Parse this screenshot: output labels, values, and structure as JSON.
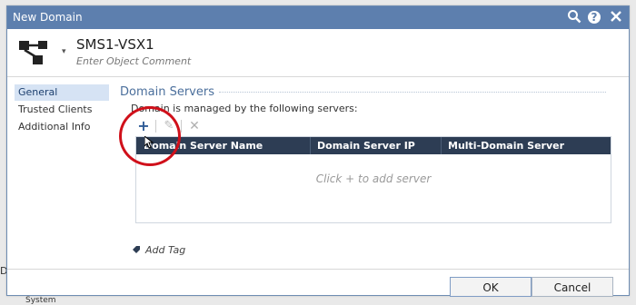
{
  "dialog": {
    "title": "New Domain",
    "titlebar_icons": [
      "search-icon",
      "help-icon",
      "close-icon"
    ],
    "accent_color": "#5d7fae"
  },
  "object": {
    "name": "SMS1-VSX1",
    "comment_placeholder": "Enter Object Comment"
  },
  "nav": {
    "items": [
      {
        "label": "General",
        "active": true
      },
      {
        "label": "Trusted Clients",
        "active": false
      },
      {
        "label": "Additional Info",
        "active": false
      }
    ]
  },
  "section": {
    "title": "Domain Servers",
    "managed_label": "Domain is managed by the following servers:"
  },
  "toolbar": {
    "add": "+",
    "edit": "✎",
    "delete": "✕"
  },
  "table": {
    "headers": [
      "Domain Server Name",
      "Domain Server IP",
      "Multi-Domain Server"
    ],
    "empty_message": "Click + to add server"
  },
  "tags": {
    "add_label": "Add Tag"
  },
  "footer": {
    "ok": "OK",
    "cancel": "Cancel"
  },
  "underlay": {
    "left_text": "Da",
    "bottom_text": "System"
  },
  "annotation": {
    "highlight_color": "#d0101a"
  }
}
